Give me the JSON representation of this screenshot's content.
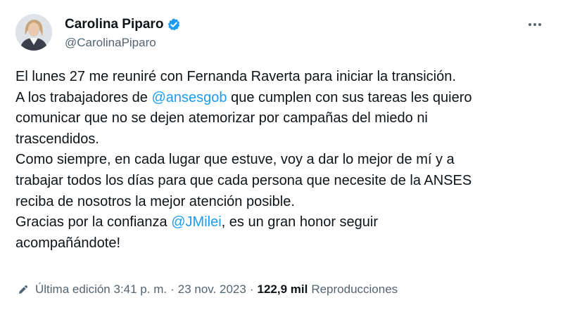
{
  "author": {
    "display_name": "Carolina Piparo",
    "handle": "@CarolinaPiparo",
    "verified": true,
    "avatar": "profile-photo"
  },
  "icons": {
    "verified": "verified-badge-icon",
    "more": "more-options-icon",
    "edit": "pencil-edit-icon"
  },
  "colors": {
    "link": "#1d9bf0",
    "text": "#0f1419",
    "secondary": "#536471"
  },
  "tweet": {
    "lines": [
      [
        {
          "text": "El lunes 27 me reuniré con Fernanda Raverta para iniciar la transición."
        }
      ],
      [
        {
          "text": "A los trabajadores de "
        },
        {
          "text": "@ansesgob",
          "mention": true
        },
        {
          "text": " que cumplen con sus tareas les quiero"
        }
      ],
      [
        {
          "text": "comunicar que no se dejen atemorizar por campañas del miedo ni"
        }
      ],
      [
        {
          "text": "trascendidos."
        }
      ],
      [
        {
          "text": "Como siempre, en cada lugar que estuve, voy a dar lo mejor de mí y a"
        }
      ],
      [
        {
          "text": "trabajar todos los días para que cada persona que necesite de la ANSES"
        }
      ],
      [
        {
          "text": "reciba de nosotros la mejor atención posible."
        }
      ],
      [
        {
          "text": "Gracias por la confianza "
        },
        {
          "text": "@JMilei",
          "mention": true
        },
        {
          "text": ", es un gran honor seguir"
        }
      ],
      [
        {
          "text": "acompañándote!"
        }
      ]
    ]
  },
  "meta": {
    "edited_label": "Última edición 3:41 p. m.",
    "separator": "·",
    "date": "23 nov. 2023",
    "views_count": "122,9 mil",
    "views_label": "Reproducciones"
  }
}
